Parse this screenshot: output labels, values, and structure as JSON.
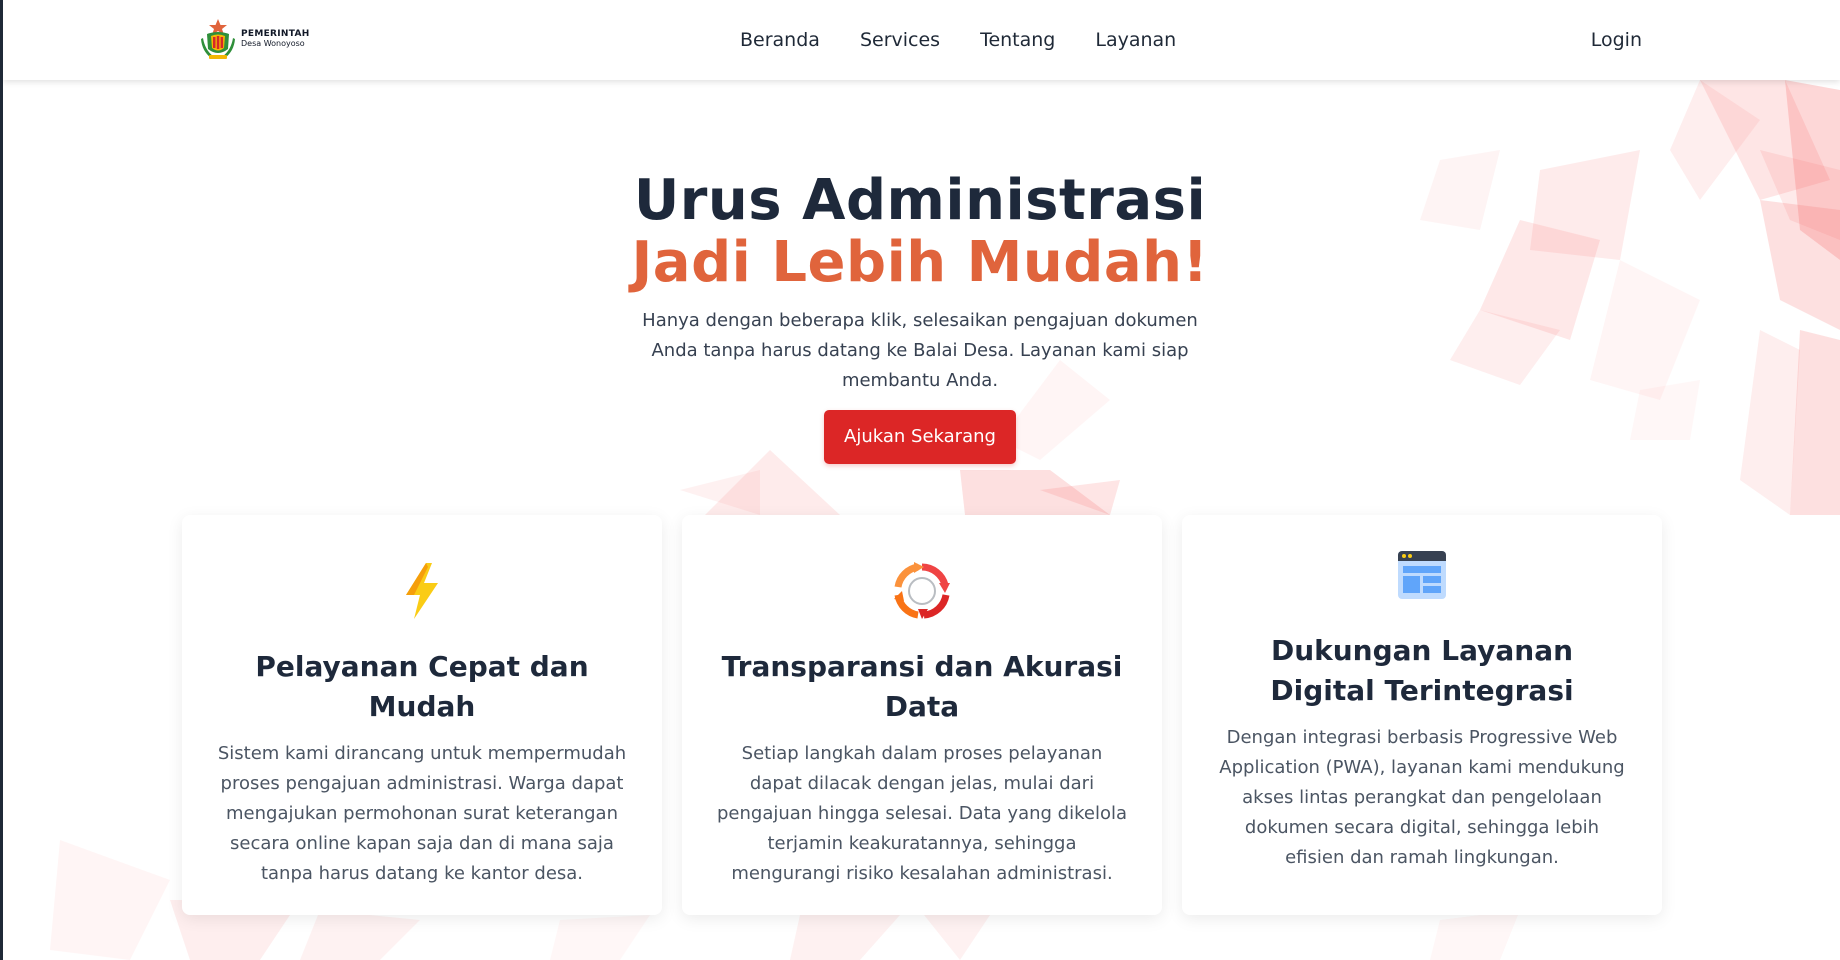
{
  "brand": {
    "line1": "PEMERINTAH",
    "line2": "Desa Wonoyoso"
  },
  "nav": {
    "items": [
      "Beranda",
      "Services",
      "Tentang",
      "Layanan"
    ],
    "login": "Login"
  },
  "hero": {
    "title_line1": "Urus Administrasi",
    "title_line2": "Jadi Lebih Mudah!",
    "description": "Hanya dengan beberapa klik, selesaikan pengajuan dokumen Anda tanpa harus datang ke Balai Desa. Layanan kami siap membantu Anda.",
    "cta_label": "Ajukan Sekarang"
  },
  "features": [
    {
      "icon": "lightning-icon",
      "title": "Pelayanan Cepat dan Mudah",
      "text": "Sistem kami dirancang untuk mempermudah proses pengajuan administrasi. Warga dapat mengajukan permohonan surat keterangan secara online kapan saja dan di mana saja tanpa harus datang ke kantor desa."
    },
    {
      "icon": "refresh-cycle-icon",
      "title": "Transparansi dan Akurasi Data",
      "text": "Setiap langkah dalam proses pelayanan dapat dilacak dengan jelas, mulai dari pengajuan hingga selesai. Data yang dikelola terjamin keakuratannya, sehingga mengurangi risiko kesalahan administrasi."
    },
    {
      "icon": "web-browser-icon",
      "title": "Dukungan Layanan Digital Terintegrasi",
      "text": "Dengan integrasi berbasis Progressive Web Application (PWA), layanan kami mendukung akses lintas perangkat dan pengelolaan dokumen secara digital, sehingga lebih efisien dan ramah lingkungan."
    }
  ],
  "colors": {
    "accent_orange": "#e0643c",
    "cta_red": "#dc2626",
    "heading_dark": "#1e293b"
  }
}
